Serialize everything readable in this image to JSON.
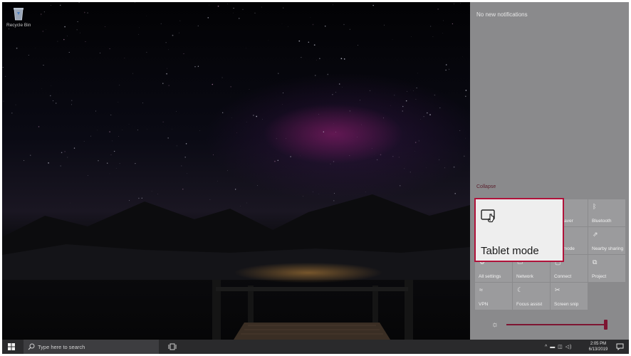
{
  "desktop": {
    "icons": [
      {
        "label": "Recycle Bin",
        "icon": "recycle-bin-icon"
      }
    ]
  },
  "action_center": {
    "notifications_text": "No new notifications",
    "collapse_label": "Collapse",
    "tiles": [
      {
        "label": "Tablet mode",
        "icon": "tablet-mode-icon"
      },
      {
        "label": "Battery saver",
        "icon": "battery-saver-icon"
      },
      {
        "label": "Bluetooth",
        "icon": "bluetooth-icon"
      },
      {
        "label": "Airplane mode",
        "icon": "airplane-mode-icon"
      },
      {
        "label": "Nearby sharing",
        "icon": "nearby-sharing-icon"
      },
      {
        "label": "All settings",
        "icon": "gear-icon"
      },
      {
        "label": "Network",
        "icon": "network-icon"
      },
      {
        "label": "Connect",
        "icon": "connect-icon"
      },
      {
        "label": "Project",
        "icon": "project-icon"
      },
      {
        "label": "VPN",
        "icon": "vpn-icon"
      },
      {
        "label": "Focus assist",
        "icon": "focus-assist-icon"
      },
      {
        "label": "Screen snip",
        "icon": "screen-snip-icon"
      }
    ],
    "visible_tile_labels": {
      "battery_saver": "ery saver",
      "airplane_mode": "ane mode"
    },
    "callout": {
      "label": "Tablet mode",
      "highlight_color": "#b0123a"
    },
    "brightness": {
      "value": 1.0,
      "icon": "brightness-icon"
    }
  },
  "taskbar": {
    "search_placeholder": "Type here to search",
    "clock": {
      "time": "2:05 PM",
      "date": "6/13/2019"
    }
  },
  "colors": {
    "accent": "#7d1532",
    "action_center_bg": "#8a8a8c",
    "taskbar_bg": "#2a2a2c"
  }
}
